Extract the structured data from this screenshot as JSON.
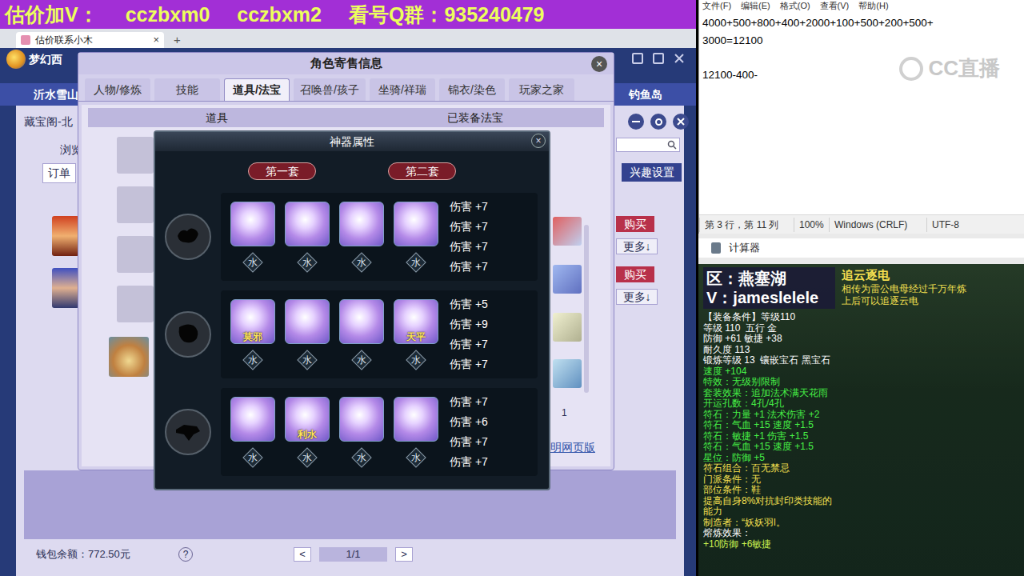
{
  "banner": {
    "parts": [
      "估价加V：",
      "cczbxm0",
      "cczbxm2",
      "看号Q群：935240479"
    ]
  },
  "browser": {
    "tab_title": "估价联系小木",
    "tab_close": "×",
    "new_tab": "+"
  },
  "game": {
    "logo": "梦幻西",
    "location_left": "沂水雪山",
    "location_right": "钓鱼岛"
  },
  "page": {
    "title": "藏宝阁-北",
    "browse": "浏览",
    "orders": "订单",
    "interest_settings": "兴趣设置",
    "listings": [
      {
        "buy": "购买",
        "more": "更多↓"
      },
      {
        "buy": "购买",
        "more": "更多↓"
      }
    ],
    "wallet": "钱包余额：772.50元",
    "help": "?",
    "prev": "<",
    "pager": "1/1",
    "next": ">"
  },
  "dialog": {
    "title": "角色寄售信息",
    "close": "×",
    "tabs": [
      {
        "label": "人物/修炼",
        "selected": false
      },
      {
        "label": "技能",
        "selected": false
      },
      {
        "label": "道具/法宝",
        "selected": true
      },
      {
        "label": "召唤兽/孩子",
        "selected": false
      },
      {
        "label": "坐骑/祥瑞",
        "selected": false
      },
      {
        "label": "锦衣/染色",
        "selected": false
      },
      {
        "label": "玩家之家",
        "selected": false
      }
    ],
    "columns": [
      "道具",
      "已装备法宝"
    ],
    "page_mark": "1",
    "web_link": "明网页版"
  },
  "artifact": {
    "title": "神器属性",
    "close": "×",
    "sets": [
      "第一套",
      "第二套"
    ],
    "rows": [
      {
        "slots": [
          {
            "element": "水"
          },
          {
            "element": "水"
          },
          {
            "element": "水"
          },
          {
            "element": "水"
          }
        ],
        "stats": [
          "伤害 +7",
          "伤害 +7",
          "伤害 +7",
          "伤害 +7"
        ]
      },
      {
        "slots": [
          {
            "label": "莫邪",
            "element": "水"
          },
          {
            "element": "水"
          },
          {
            "element": "水"
          },
          {
            "label": "天平",
            "element": "水"
          }
        ],
        "stats": [
          "伤害 +5",
          "伤害 +9",
          "伤害 +7",
          "伤害 +7"
        ]
      },
      {
        "slots": [
          {
            "element": "水"
          },
          {
            "label": "利水",
            "element": "水"
          },
          {
            "element": "水"
          },
          {
            "element": "水"
          }
        ],
        "stats": [
          "伤害 +7",
          "伤害 +6",
          "伤害 +7",
          "伤害 +7"
        ]
      }
    ]
  },
  "notepad": {
    "menu": [
      "文件(F)",
      "编辑(E)",
      "格式(O)",
      "查看(V)",
      "帮助(H)"
    ],
    "lines": [
      "4000+500+800+400+2000+100+500+200+500+",
      "3000=12100",
      "",
      "12100-400-"
    ],
    "status": [
      "第 3 行，第 11 列",
      "100%",
      "Windows (CRLF)",
      "UTF-8"
    ],
    "watermark": "CC直播"
  },
  "calculator": {
    "title": "计算器"
  },
  "stream": {
    "region": "区：燕塞湖",
    "contact": "V：jameslelele",
    "item_name": "追云逐电",
    "description": [
      "相传为雷公电母经过千万年炼",
      "上后可以追逐云电"
    ],
    "lines": [
      {
        "text": "【装备条件】等级110",
        "color": "#ffffff"
      },
      {
        "text": "等级 110  五行 金",
        "color": "#ffffff"
      },
      {
        "text": "防御 +61 敏捷 +38",
        "color": "#ffffff"
      },
      {
        "text": "耐久度 113",
        "color": "#ffffff"
      },
      {
        "text": "锻炼等级 13  镶嵌宝石 黑宝石",
        "color": "#ffffff"
      },
      {
        "text": "速度 +104",
        "color": "#46f046"
      },
      {
        "text": "特效：无级别限制",
        "color": "#46f046"
      },
      {
        "text": "套装效果：追加法术满天花雨",
        "color": "#46f046"
      },
      {
        "text": "开运孔数：4孔/4孔",
        "color": "#46f046"
      },
      {
        "text": "符石：力量 +1 法术伤害 +2",
        "color": "#46f046"
      },
      {
        "text": "符石：气血 +15 速度 +1.5",
        "color": "#46f046"
      },
      {
        "text": "符石：敏捷 +1 伤害 +1.5",
        "color": "#46f046"
      },
      {
        "text": "符石：气血 +15 速度 +1.5",
        "color": "#46f046"
      },
      {
        "text": "星位：防御 +5",
        "color": "#46f046"
      },
      {
        "text": "符石组合：百无禁忌",
        "color": "#f5e050"
      },
      {
        "text": "门派条件：无",
        "color": "#f5e050"
      },
      {
        "text": "部位条件：鞋",
        "color": "#f5e050"
      },
      {
        "text": "提高自身8%对抗封印类技能的",
        "color": "#f5e050"
      },
      {
        "text": "能力",
        "color": "#f5e050"
      },
      {
        "text": "制造者：“妖妖羽l。",
        "color": "#f5e050"
      },
      {
        "text": "熔炼效果：",
        "color": "#ffffff"
      },
      {
        "text": "+10防御 +6敏捷",
        "color": "#c8f050"
      }
    ]
  }
}
